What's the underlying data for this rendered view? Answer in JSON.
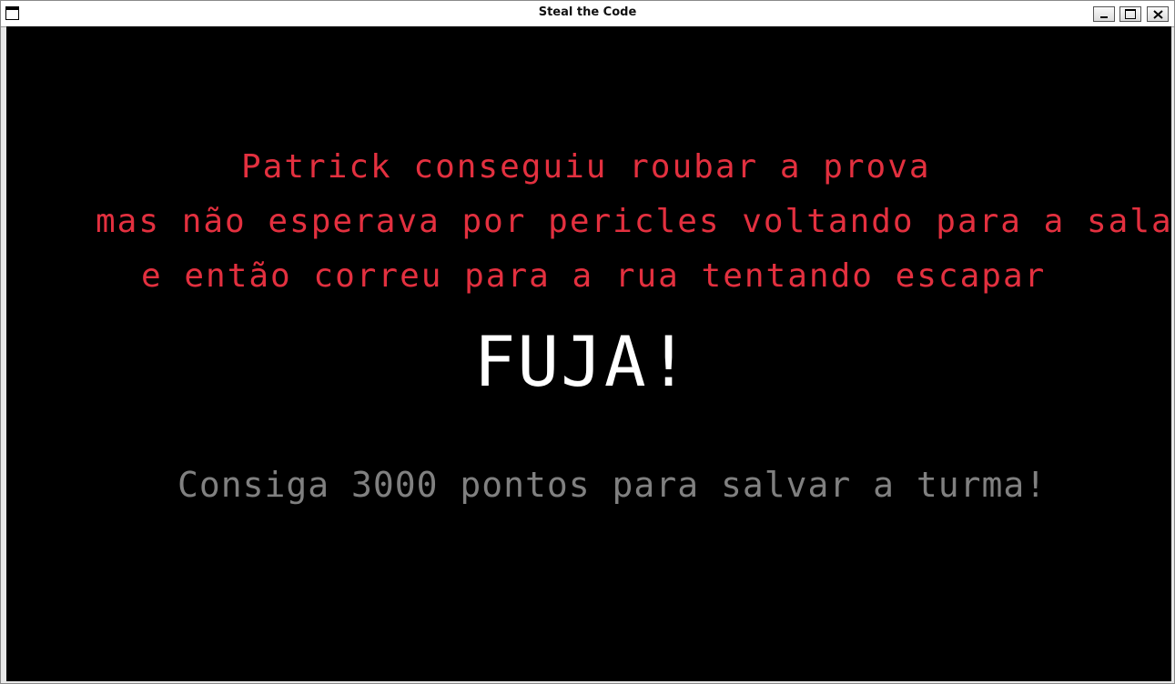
{
  "window": {
    "title": "Steal the Code"
  },
  "story": {
    "lines": [
      "Patrick conseguiu roubar a prova",
      "mas não esperava por pericles voltando para a sala",
      "e então correu para a rua tentando escapar"
    ],
    "headline": "FUJA!",
    "goal": "Consiga 3000 pontos para salvar a turma!"
  },
  "colors": {
    "story_text": "#e3303f",
    "headline_text": "#ffffff",
    "goal_text": "#808080",
    "background": "#000000"
  },
  "icons": {
    "system_menu": "window-menu-icon",
    "minimize": "minimize-icon",
    "maximize": "maximize-icon",
    "close": "close-icon"
  }
}
